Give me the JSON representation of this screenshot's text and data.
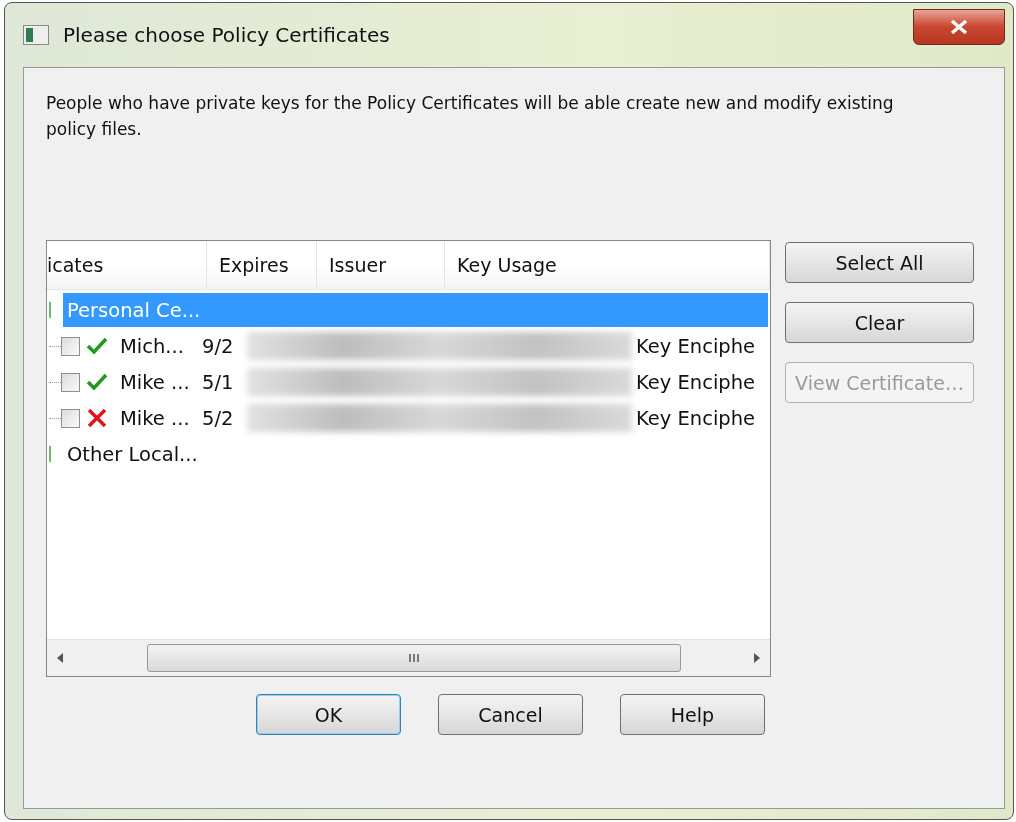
{
  "window": {
    "title": "Please choose Policy Certificates"
  },
  "description": "People who have private keys for the Policy Certificates will be able create new and modify existing policy files.",
  "table": {
    "columns": [
      "icates",
      "Expires",
      "Issuer",
      "Key Usage"
    ],
    "groups": [
      {
        "label": "Personal Ce...",
        "selected": true,
        "children": [
          {
            "checked": false,
            "kind": "valid",
            "name": "Mich...",
            "expires": "9/2",
            "key_usage": "Key Enciphe"
          },
          {
            "checked": false,
            "kind": "valid",
            "name": "Mike ...",
            "expires": "5/1",
            "key_usage": "Key Enciphe"
          },
          {
            "checked": false,
            "kind": "invalid",
            "name": "Mike ...",
            "expires": "5/2",
            "key_usage": "Key Enciphe"
          }
        ]
      },
      {
        "label": "Other Local...",
        "selected": false
      }
    ]
  },
  "side_buttons": [
    {
      "label": "Select All",
      "disabled": false
    },
    {
      "label": "Clear",
      "disabled": false
    },
    {
      "label": "View Certificate…",
      "disabled": true
    }
  ],
  "buttons": [
    {
      "label": "OK",
      "default": true
    },
    {
      "label": "Cancel",
      "default": false
    },
    {
      "label": "Help",
      "default": false
    }
  ]
}
